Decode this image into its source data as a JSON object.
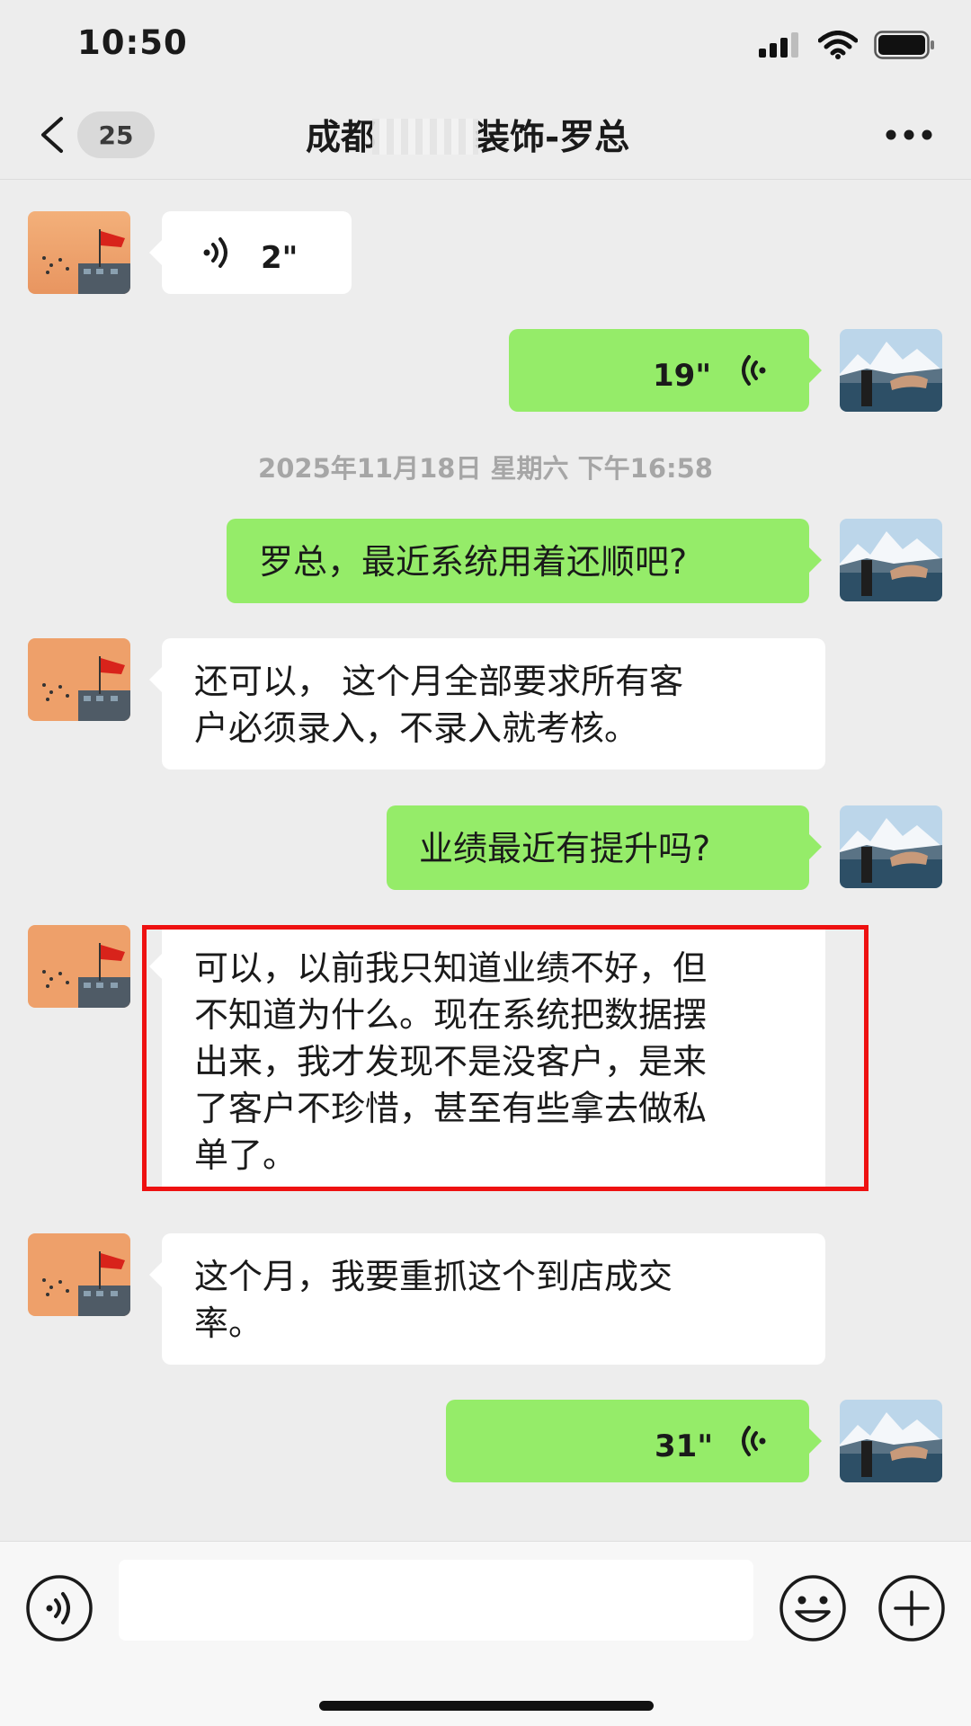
{
  "status_bar": {
    "time": "10:50"
  },
  "header": {
    "unread_count": "25",
    "title_prefix": "成都",
    "title_suffix": "装饰-罗总"
  },
  "messages": [
    {
      "side": "in",
      "type": "voice",
      "duration": "2\""
    },
    {
      "side": "out",
      "type": "voice",
      "duration": "19\""
    },
    {
      "side": "out",
      "type": "text",
      "text": "罗总，最近系统用着还顺吧?"
    },
    {
      "side": "in",
      "type": "text",
      "lines": [
        "还可以， 这个月全部要求所有客",
        "户必须录入，不录入就考核。"
      ]
    },
    {
      "side": "out",
      "type": "text",
      "text": "业绩最近有提升吗?"
    },
    {
      "side": "in",
      "type": "text",
      "lines": [
        "可以，以前我只知道业绩不好，但",
        "不知道为什么。现在系统把数据摆",
        "出来，我才发现不是没客户，是来",
        "了客户不珍惜，甚至有些拿去做私",
        "单了。"
      ]
    },
    {
      "side": "in",
      "type": "text",
      "lines": [
        "这个月，我要重抓这个到店成交",
        "率。"
      ]
    },
    {
      "side": "out",
      "type": "voice",
      "duration": "31\""
    }
  ],
  "timestamp": "2025年11月18日 星期六 下午16:58",
  "input_bar": {
    "left_icon": "voice-mode-icon",
    "right_icons": [
      "emoji-icon",
      "plus-icon"
    ]
  },
  "colors": {
    "background": "#ededed",
    "outgoing_bubble": "#95ec69",
    "incoming_bubble": "#ffffff",
    "highlight_border": "#ee1111"
  }
}
